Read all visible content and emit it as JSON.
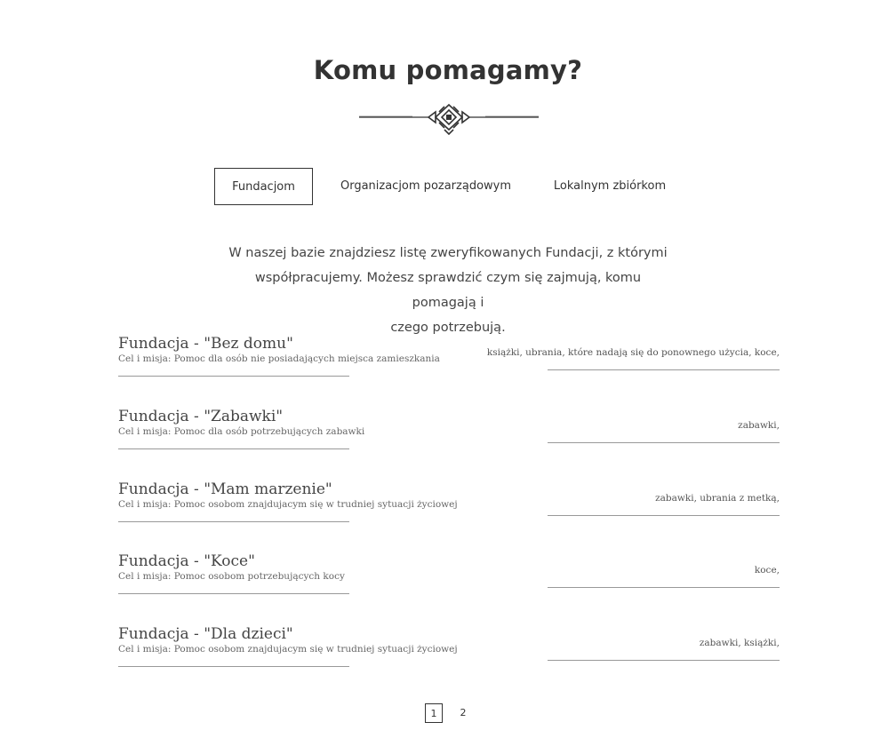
{
  "page": {
    "title": "Komu pomagamy?"
  },
  "tabs": [
    {
      "label": "Fundacjom",
      "active": true
    },
    {
      "label": "Organizacjom pozarządowym",
      "active": false
    },
    {
      "label": "Lokalnym zbiórkom",
      "active": false
    }
  ],
  "intro": {
    "line1": "W naszej bazie znajdziesz listę zweryfikowanych Fundacji, z którymi",
    "line2": "współpracujemy. Możesz sprawdzić czym się zajmują, komu pomagają i",
    "line3": "czego potrzebują."
  },
  "items": [
    {
      "name": "Fundacja - \"Bez domu\"",
      "mission": "Cel i misja: Pomoc dla osób nie posiadających miejsca zamieszkania",
      "needs": "książki, ubrania, które nadają się do ponownego użycia, koce,"
    },
    {
      "name": "Fundacja - \"Zabawki\"",
      "mission": "Cel i misja: Pomoc dla osób potrzebujących zabawki",
      "needs": "zabawki,"
    },
    {
      "name": "Fundacja - \"Mam marzenie\"",
      "mission": "Cel i misja: Pomoc osobom znajdujacym się w trudniej sytuacji życiowej",
      "needs": "zabawki, ubrania z metką,"
    },
    {
      "name": "Fundacja - \"Koce\"",
      "mission": "Cel i misja: Pomoc osobom potrzebujących kocy",
      "needs": "koce,"
    },
    {
      "name": "Fundacja - \"Dla dzieci\"",
      "mission": "Cel i misja: Pomoc osobom znajdujacym się w trudniej sytuacji życiowej",
      "needs": "zabawki, książki,"
    }
  ],
  "pagination": {
    "pages": [
      "1",
      "2"
    ],
    "current": "1"
  },
  "colors": {
    "text": "#333333",
    "line": "#999999"
  },
  "icons": {
    "ornament": "decorative-divider-icon"
  }
}
